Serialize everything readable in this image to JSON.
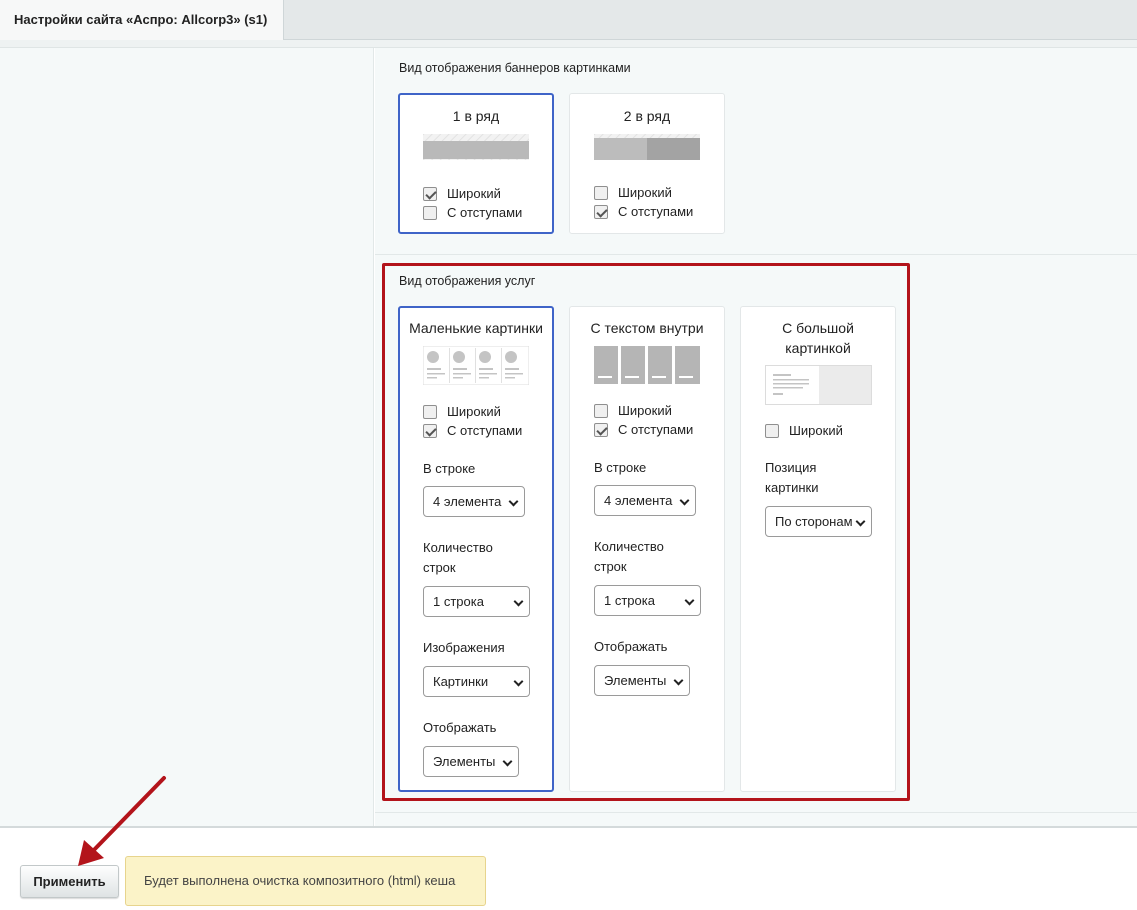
{
  "tab": {
    "title": "Настройки сайта «Аспро: Allcorp3» (s1)"
  },
  "banners": {
    "title": "Вид отображения баннеров картинками",
    "cards": [
      {
        "title": "1 в ряд",
        "wide_label": "Широкий",
        "wide_checked": true,
        "padding_label": "С отступами",
        "padding_checked": false,
        "active": true
      },
      {
        "title": "2 в ряд",
        "wide_label": "Широкий",
        "wide_checked": false,
        "padding_label": "С отступами",
        "padding_checked": true,
        "active": false
      }
    ]
  },
  "services": {
    "title": "Вид отображения услуг",
    "cards": [
      {
        "title": "Маленькие картинки",
        "active": true,
        "wide_label": "Широкий",
        "wide_checked": false,
        "padding_label": "С отступами",
        "padding_checked": true,
        "in_row_label": "В строке",
        "in_row_value": "4 элемента",
        "rows_label_1": "Количество",
        "rows_label_2": "строк",
        "rows_value": "1 строка",
        "images_label": "Изображения",
        "images_value": "Картинки",
        "show_label": "Отображать",
        "show_value": "Элементы"
      },
      {
        "title": "С текстом внутри",
        "active": false,
        "wide_label": "Широкий",
        "wide_checked": false,
        "padding_label": "С отступами",
        "padding_checked": true,
        "in_row_label": "В строке",
        "in_row_value": "4 элемента",
        "rows_label_1": "Количество",
        "rows_label_2": "строк",
        "rows_value": "1 строка",
        "show_label": "Отображать",
        "show_value": "Элементы"
      },
      {
        "title_1": "С большой",
        "title_2": "картинкой",
        "active": false,
        "wide_label": "Широкий",
        "wide_checked": false,
        "position_label_1": "Позиция",
        "position_label_2": "картинки",
        "position_value": "По сторонам"
      }
    ]
  },
  "footer": {
    "apply_label": "Применить",
    "notice": "Будет выполнена очистка композитного (html) кеша"
  },
  "colors": {
    "active_border": "#3f64c8",
    "highlight": "#b3141b",
    "arrow": "#b3141b",
    "notice_bg": "#fbf3c8"
  }
}
